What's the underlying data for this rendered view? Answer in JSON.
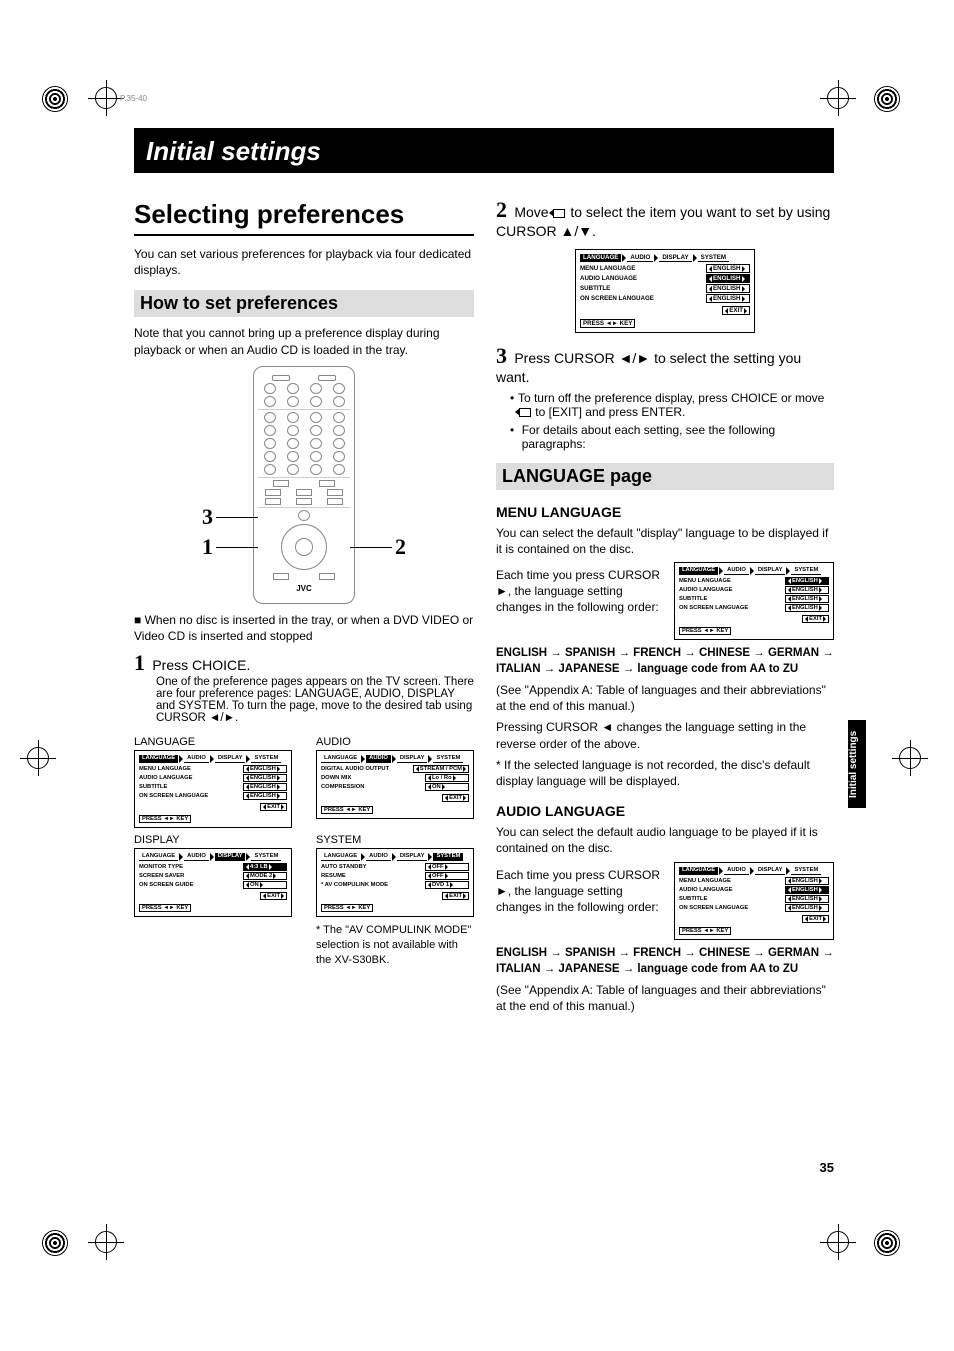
{
  "top_marker": "P.35-40",
  "header_bar": "Initial settings",
  "section_title": "Selecting preferences",
  "intro": "You can set various preferences for playback via four dedicated displays.",
  "howto_heading": "How to set preferences",
  "howto_note": "Note that you cannot bring up a preference display during playback or when an Audio CD is loaded in the tray.",
  "tray_note": "When no disc is inserted in the tray, or when a DVD VIDEO or Video CD is inserted and stopped",
  "remote_callouts": {
    "one": "1",
    "two": "2",
    "three": "3"
  },
  "remote_brand": "JVC",
  "step1": {
    "num": "1",
    "action": "Press CHOICE.",
    "body": "One of the preference pages appears on the TV screen. There are four preference pages: LANGUAGE, AUDIO, DISPLAY and SYSTEM. To turn the page, move        to the desired tab using CURSOR ◄/►."
  },
  "panels": {
    "language_label": "LANGUAGE",
    "audio_label": "AUDIO",
    "display_label": "DISPLAY",
    "system_label": "SYSTEM",
    "tabs": [
      "LANGUAGE",
      "AUDIO",
      "DISPLAY",
      "SYSTEM"
    ],
    "language_rows": [
      {
        "k": "MENU LANGUAGE",
        "v": "ENGLISH"
      },
      {
        "k": "AUDIO LANGUAGE",
        "v": "ENGLISH"
      },
      {
        "k": "SUBTITLE",
        "v": "ENGLISH"
      },
      {
        "k": "ON SCREEN LANGUAGE",
        "v": "ENGLISH"
      }
    ],
    "audio_rows": [
      {
        "k": "DIGITAL AUDIO OUTPUT",
        "v": "STREAM / PCM"
      },
      {
        "k": "DOWN MIX",
        "v": "Lo / Ro"
      },
      {
        "k": "COMPRESSION",
        "v": "ON"
      }
    ],
    "display_rows": [
      {
        "k": "MONITOR TYPE",
        "v": "4:3 LB"
      },
      {
        "k": "SCREEN SAVER",
        "v": "MODE 2"
      },
      {
        "k": "ON SCREEN GUIDE",
        "v": "ON"
      }
    ],
    "system_rows": [
      {
        "k": "AUTO STANDBY",
        "v": "OFF"
      },
      {
        "k": "RESUME",
        "v": "OFF"
      },
      {
        "k": "AV COMPULINK MODE",
        "v": "DVD 1"
      }
    ],
    "system_star": "*",
    "exit": "EXIT",
    "press": "PRESS",
    "key": "KEY"
  },
  "system_note": "* The \"AV COMPULINK MODE\" selection is not available with the XV-S30BK.",
  "step2": {
    "num": "2",
    "action_pre": "Move ",
    "action_post": " to select the item you want to set by using CURSOR ▲/▼."
  },
  "step3": {
    "num": "3",
    "action": "Press CURSOR ◄/► to select the setting you want.",
    "b1_pre": "To turn off the preference display, press CHOICE or move ",
    "b1_post": " to [EXIT] and press ENTER.",
    "b2": "For details about each setting, see the following paragraphs:"
  },
  "lang_page_heading": "LANGUAGE page",
  "menu_lang": {
    "h": "MENU LANGUAGE",
    "p1": "You can select the default \"display\" language to be displayed if it is contained on the disc.",
    "p2": "Each time you press CURSOR ►, the language setting changes in the following order:",
    "order1": "ENGLISH → SPANISH → FRENCH → CHINESE → GERMAN → ITALIAN → JAPANESE → language code from AA to ZU",
    "appendix": "(See \"Appendix A: Table of languages and their abbreviations\" at the end of this manual.)",
    "p3": "Pressing CURSOR ◄ changes the language setting in the reverse order of the above.",
    "p4": "*  If the selected language is not recorded, the disc's default display language will be displayed."
  },
  "audio_lang": {
    "h": "AUDIO LANGUAGE",
    "p1": "You can select the default audio language to be played if it is contained on the disc.",
    "p2": "Each time you press CURSOR ►, the language setting changes in the following order:",
    "order": "ENGLISH → SPANISH → FRENCH → CHINESE → GERMAN → ITALIAN → JAPANESE → language code from AA to ZU",
    "appendix": "(See \"Appendix A: Table of languages and their abbreviations\" at the end of this manual.)"
  },
  "side_tab": "Initial settings",
  "page_number": "35"
}
